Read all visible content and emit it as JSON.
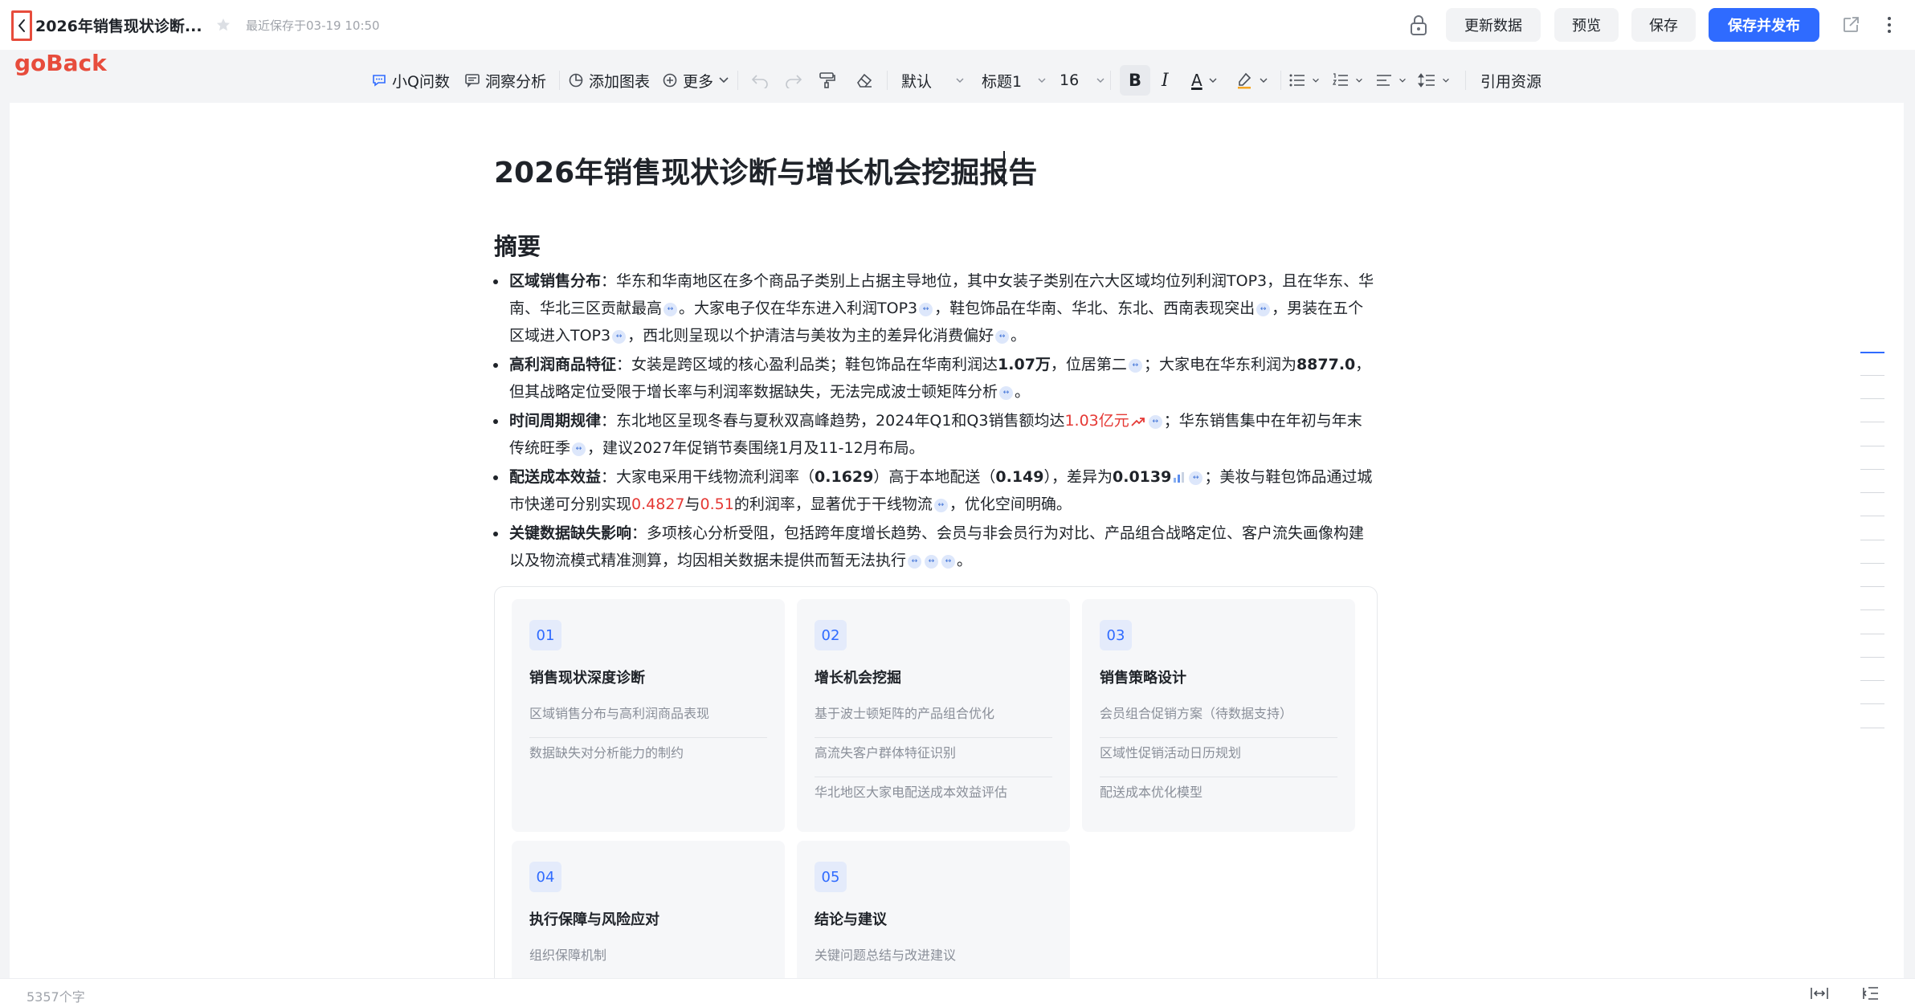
{
  "header": {
    "doc_name": "2026年销售现状诊断...",
    "saved_text": "最近保存于03-19 10:50",
    "goback_label": "goBack",
    "buttons": {
      "update_data": "更新数据",
      "preview": "预览",
      "save": "保存",
      "save_publish": "保存并发布"
    },
    "accent_color": "#2f6bff"
  },
  "toolbar": {
    "ask": "小Q问数",
    "insight": "洞察分析",
    "add_chart": "添加图表",
    "more": "更多",
    "font_family": "默认",
    "heading": "标题1",
    "font_size": "16",
    "bold": "B",
    "italic": "I",
    "font_color": "A",
    "references": "引用资源"
  },
  "document": {
    "title": "2026年销售现状诊断与增长机会挖掘报告",
    "summary_heading": "摘要",
    "bullets": [
      {
        "label": "区域销售分布",
        "p1": "：华东和华南地区在多个商品子类别上占据主导地位，其中女装子类别在六大区域均位列利润TOP3，且在华东、华南、华北三区贡献最高",
        "p2": "。大家电子仅在华东进入利润TOP3",
        "p3": "，鞋包饰品在华南、华北、东北、西南表现突出",
        "p4": "，男装在五个区域进入TOP3",
        "p5": "，西北则呈现以个护清洁与美妆为主的差异化消费偏好",
        "p6": "。"
      },
      {
        "label": "高利润商品特征",
        "p1": "：女装是跨区域的核心盈利品类；鞋包饰品在华南利润达",
        "v1": "1.07万",
        "p2": "，位居第二",
        "p3": "；大家电在华东利润为",
        "v2": "8877.0",
        "p4": "，但其战略定位受限于增长率与利润率数据缺失，无法完成波士顿矩阵分析",
        "p5": "。"
      },
      {
        "label": "时间周期规律",
        "p1": "：东北地区呈现冬春与夏秋双高峰趋势，2024年Q1和Q3销售额均达",
        "v1": "1.03亿元",
        "p2": "；华东销售集中在年初与年末传统旺季",
        "p3": "，建议2027年促销节奏围绕1月及11-12月布局。"
      },
      {
        "label": "配送成本效益",
        "p1": "：大家电采用干线物流利润率（",
        "v1": "0.1629",
        "p2": "）高于本地配送（",
        "v2": "0.149",
        "p3": "），差异为",
        "v3": "0.0139",
        "p4": "；美妆与鞋包饰品通过城市快递可分别实现",
        "v4": "0.4827",
        "p5": "与",
        "v5": "0.51",
        "p6": "的利润率，显著优于干线物流",
        "p7": "，优化空间明确。"
      },
      {
        "label": "关键数据缺失影响",
        "p1": "：多项核心分析受阻，包括跨年度增长趋势、会员与非会员行为对比、产品组合战略定位、客户流失画像构建以及物流模式精准测算，均因相关数据未提供而暂无法执行",
        "p2": "。"
      }
    ],
    "outline_cards": [
      {
        "num": "01",
        "title": "销售现状深度诊断",
        "items": [
          "区域销售分布与高利润商品表现",
          "数据缺失对分析能力的制约"
        ]
      },
      {
        "num": "02",
        "title": "增长机会挖掘",
        "items": [
          "基于波士顿矩阵的产品组合优化",
          "高流失客户群体特征识别",
          "华北地区大家电配送成本效益评估"
        ]
      },
      {
        "num": "03",
        "title": "销售策略设计",
        "items": [
          "会员组合促销方案（待数据支持）",
          "区域性促销活动日历规划",
          "配送成本优化模型"
        ]
      },
      {
        "num": "04",
        "title": "执行保障与风险应对",
        "items": [
          "组织保障机制"
        ]
      },
      {
        "num": "05",
        "title": "结论与建议",
        "items": [
          "关键问题总结与改进建议"
        ]
      }
    ]
  },
  "footer": {
    "word_count": "5357个字"
  }
}
